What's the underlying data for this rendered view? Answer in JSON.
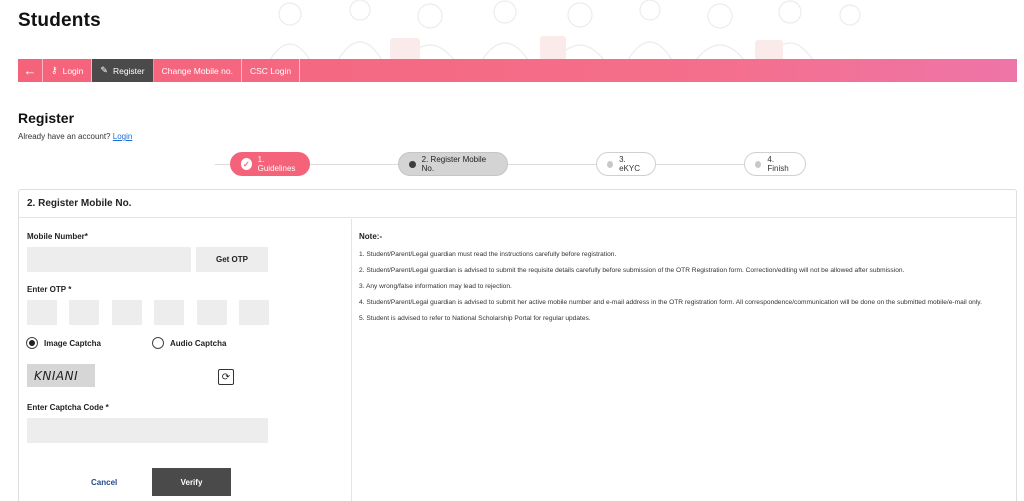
{
  "page": {
    "title": "Students"
  },
  "nav": {
    "back_icon": "arrow-left-icon",
    "items": [
      {
        "label": "Login",
        "icon": "key-icon",
        "active": false
      },
      {
        "label": "Register",
        "icon": "edit-icon",
        "active": true
      },
      {
        "label": "Change Mobile no.",
        "icon": "",
        "active": false
      },
      {
        "label": "CSC Login",
        "icon": "",
        "active": false
      }
    ],
    "colors": {
      "bar": "#f5637a",
      "active": "#4a4a4a"
    }
  },
  "register": {
    "title": "Register",
    "already_text": "Already have an account?",
    "login_link": "Login"
  },
  "steps": [
    {
      "label": "1. Guidelines",
      "state": "done"
    },
    {
      "label": "2. Register Mobile No.",
      "state": "current"
    },
    {
      "label": "3. eKYC",
      "state": "pending"
    },
    {
      "label": "4. Finish",
      "state": "pending"
    }
  ],
  "panel": {
    "title": "2. Register Mobile No.",
    "mobile_label": "Mobile Number*",
    "mobile_value": "",
    "get_otp": "Get OTP",
    "otp_label": "Enter OTP *",
    "otp_digits": [
      "",
      "",
      "",
      "",
      "",
      ""
    ],
    "radio_image": "Image Captcha",
    "radio_audio": "Audio Captcha",
    "selected_captcha": "Image Captcha",
    "captcha_text": "KNIANI",
    "captcha_code_label": "Enter Captcha Code *",
    "captcha_code_value": "",
    "cancel": "Cancel",
    "verify": "Verify"
  },
  "note": {
    "title": "Note:-",
    "items": [
      "1. Student/Parent/Legal guardian must read the instructions carefully before registration.",
      "2. Student/Parent/Legal guardian is advised to submit the requisite details carefully before submission of the OTR Registration form. Correction/editing will not be allowed after submission.",
      "3. Any wrong/false information may lead to rejection.",
      "4. Student/Parent/Legal guardian is advised to submit her active mobile number and e-mail address in the OTR registration form. All correspondence/communication will be done on the submitted mobile/e-mail only.",
      "5. Student is advised to refer to National Scholarship Portal for regular updates."
    ]
  }
}
